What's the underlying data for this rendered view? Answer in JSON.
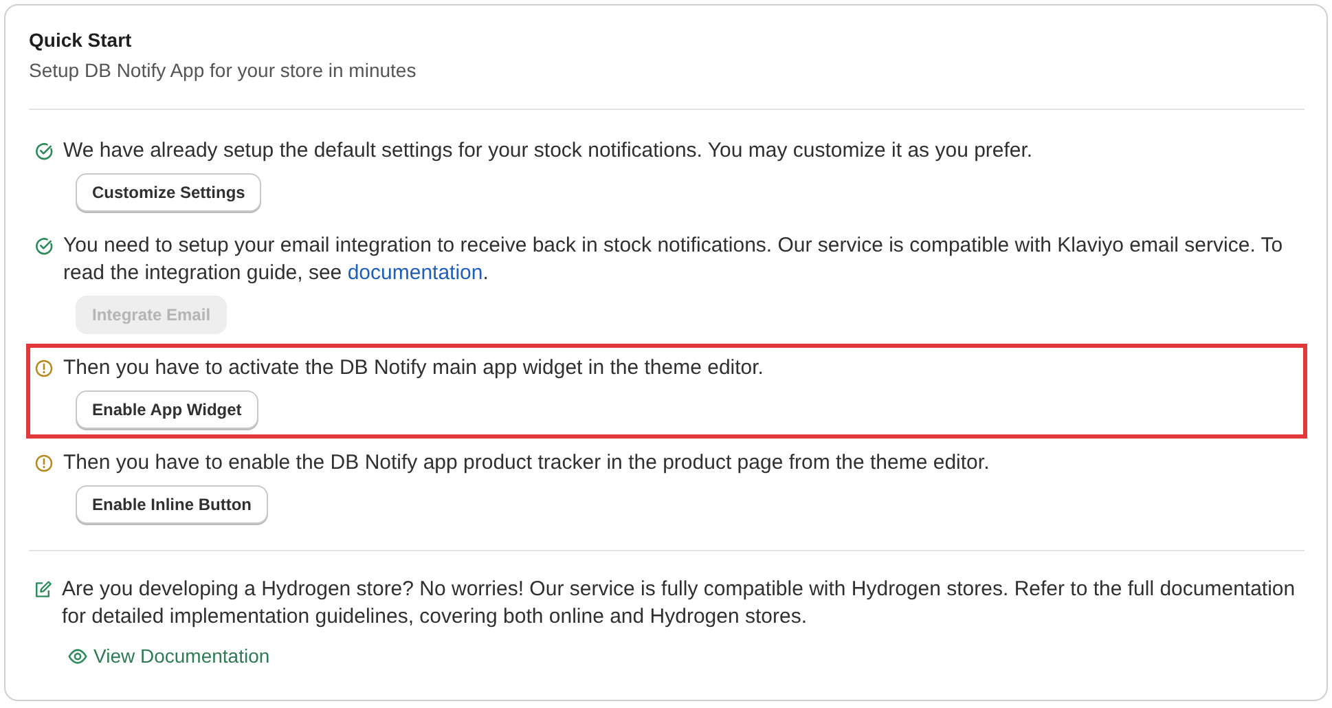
{
  "card": {
    "title": "Quick Start",
    "subtitle": "Setup DB Notify App for your store in minutes"
  },
  "steps": [
    {
      "kind": "done",
      "highlighted": false,
      "text": "We have already setup the default settings for your stock notifications. You may customize it as you prefer.",
      "button": {
        "label": "Customize Settings",
        "disabled": false
      }
    },
    {
      "kind": "done",
      "highlighted": false,
      "text": "You need to setup your email integration to receive back in stock notifications. Our service is compatible with Klaviyo email service. To read the integration guide, see ",
      "link": "documentation",
      "text_after": ".",
      "button": {
        "label": "Integrate Email",
        "disabled": true
      }
    },
    {
      "kind": "pending",
      "highlighted": true,
      "text": "Then you have to activate the DB Notify main app widget in the theme editor.",
      "button": {
        "label": "Enable App Widget",
        "disabled": false
      }
    },
    {
      "kind": "pending",
      "highlighted": false,
      "text": "Then you have to enable the DB Notify app product tracker in the product page from the theme editor.",
      "button": {
        "label": "Enable Inline Button",
        "disabled": false
      }
    }
  ],
  "hydrogen": {
    "text": "Are you developing a Hydrogen store? No worries! Our service is fully compatible with Hydrogen stores. Refer to the full documentation for detailed implementation guidelines, covering both online and Hydrogen stores.",
    "link": "View Documentation"
  }
}
